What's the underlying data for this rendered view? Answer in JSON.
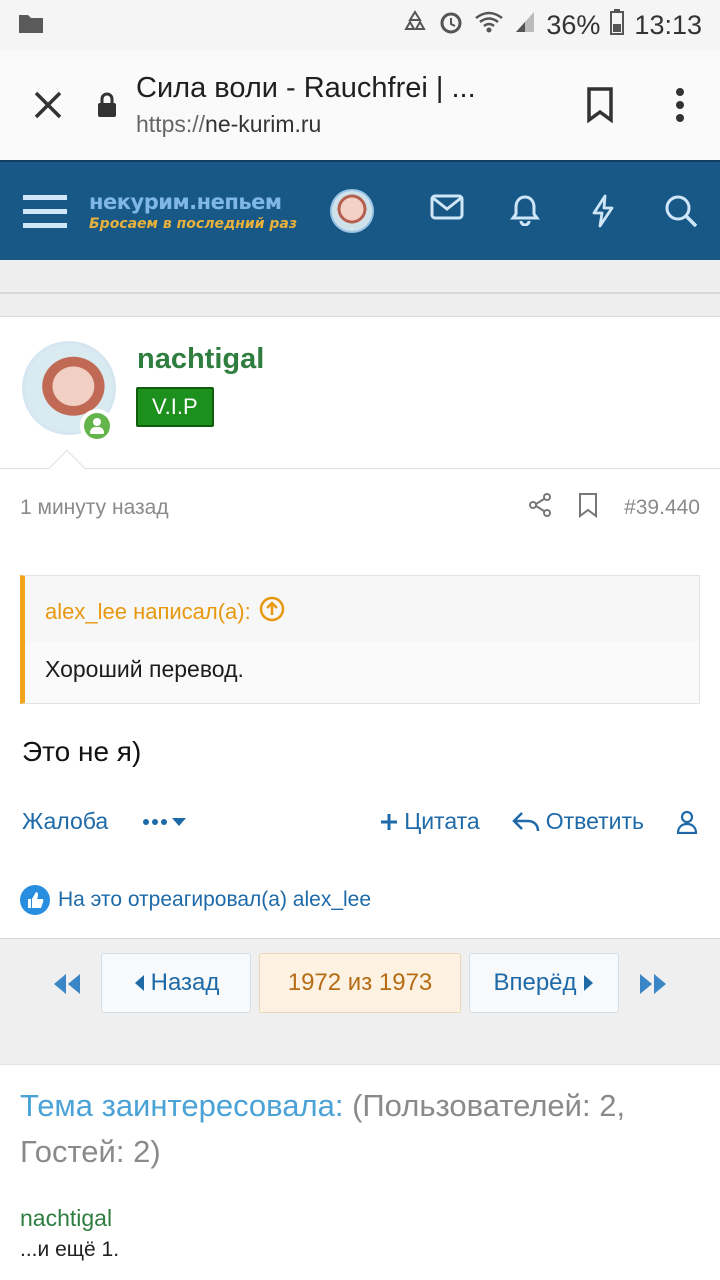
{
  "status": {
    "battery": "36%",
    "time": "13:13"
  },
  "browser": {
    "title": "Сила воли - Rauchfrei | ...",
    "url_scheme": "https://",
    "url_domain": "ne-kurim.ru"
  },
  "site": {
    "logo_line1": "некурим.непьем",
    "logo_line2": "Бросаем в последний раз"
  },
  "post": {
    "username": "nachtigal",
    "badge": "V.I.P",
    "time": "1 минуту назад",
    "post_number": "#39.440",
    "quote_author": "alex_lee написал(а):",
    "quote_text": "Хороший перевод.",
    "message": "Это не я)",
    "actions": {
      "report": "Жалоба",
      "quote": "Цитата",
      "reply": "Ответить"
    },
    "reaction_text": "На это отреагировал(а) alex_lee"
  },
  "pagination": {
    "prev": "Назад",
    "current": "1972 из 1973",
    "next": "Вперёд"
  },
  "viewers": {
    "title": "Тема заинтересовала:",
    "stats": " (Пользователей: 2, Гостей: 2)",
    "user": "nachtigal",
    "more": "...и ещё 1."
  },
  "colors": {
    "navbar": "#185886",
    "username": "#2f7d3f",
    "link": "#1e6aa8",
    "quote_accent": "#f0a41b",
    "badge": "#1d8f1d"
  }
}
